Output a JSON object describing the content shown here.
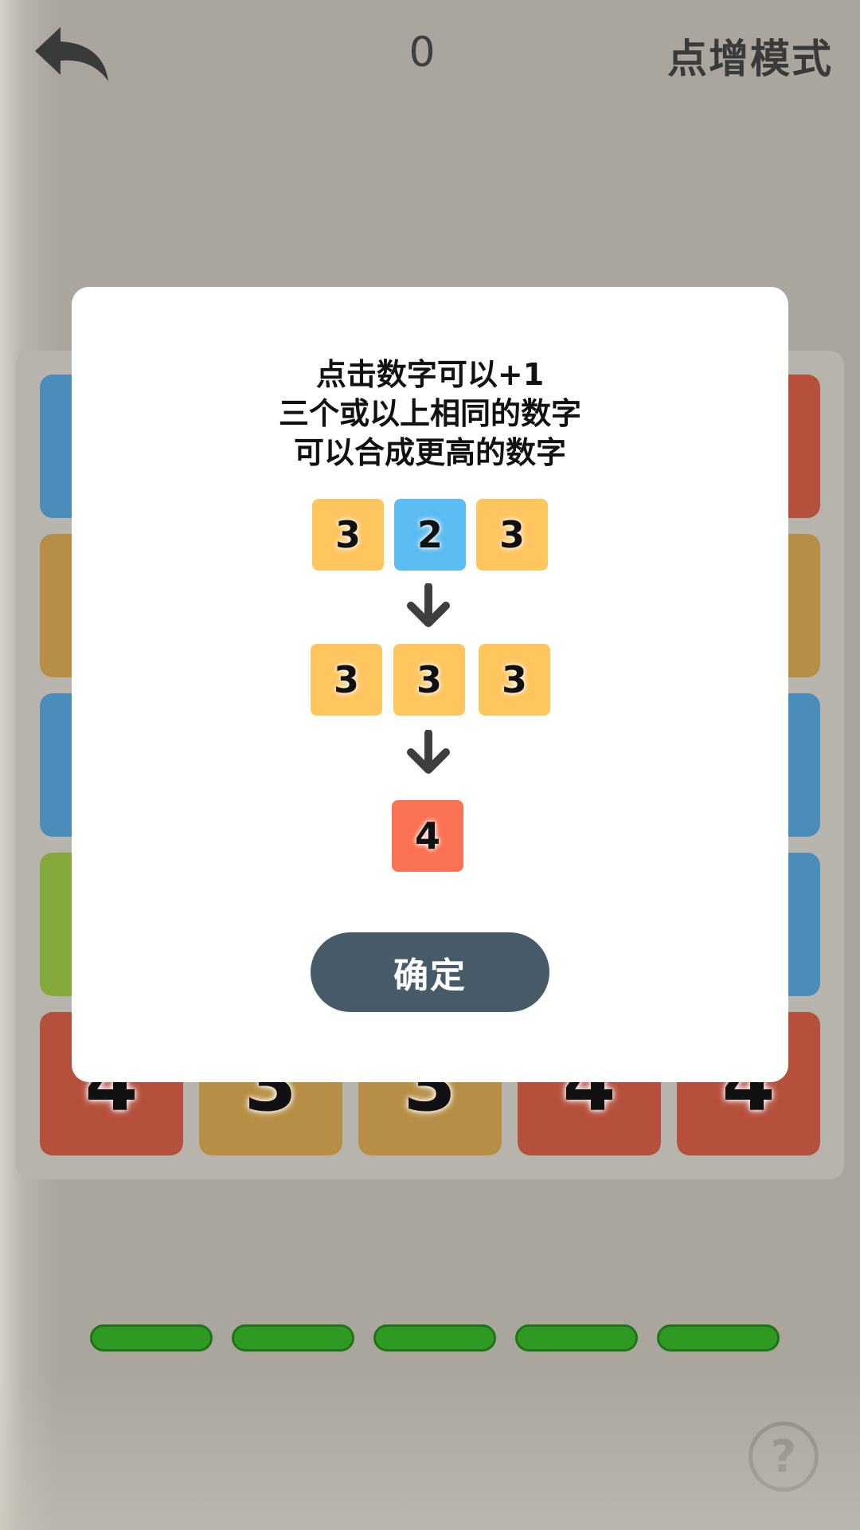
{
  "header": {
    "score": "0",
    "mode_title": "点增模式"
  },
  "board": {
    "bottom_row": [
      "4",
      "3",
      "3",
      "4",
      "4"
    ]
  },
  "help": {
    "label": "?"
  },
  "modal": {
    "instructions": [
      "点击数字可以+1",
      "三个或以上相同的数字",
      "可以合成更高的数字"
    ],
    "example_row1": [
      "3",
      "2",
      "3"
    ],
    "example_row2": [
      "3",
      "3",
      "3"
    ],
    "example_result": "4",
    "confirm_label": "确定"
  },
  "colors": {
    "background": "#aaa69e",
    "tile_blue": "#4b8dba",
    "tile_gold": "#b68e45",
    "tile_green": "#85a83a",
    "tile_red": "#b5503d",
    "progress_green": "#2e9a23",
    "mini_yellow": "#ffc55e",
    "mini_blue": "#5abcf0",
    "mini_orange": "#fb7154",
    "confirm_button": "#465a68"
  },
  "icons": {
    "back": "back-arrow-icon",
    "help": "question-circle-icon",
    "down_arrow": "arrow-down-icon"
  }
}
